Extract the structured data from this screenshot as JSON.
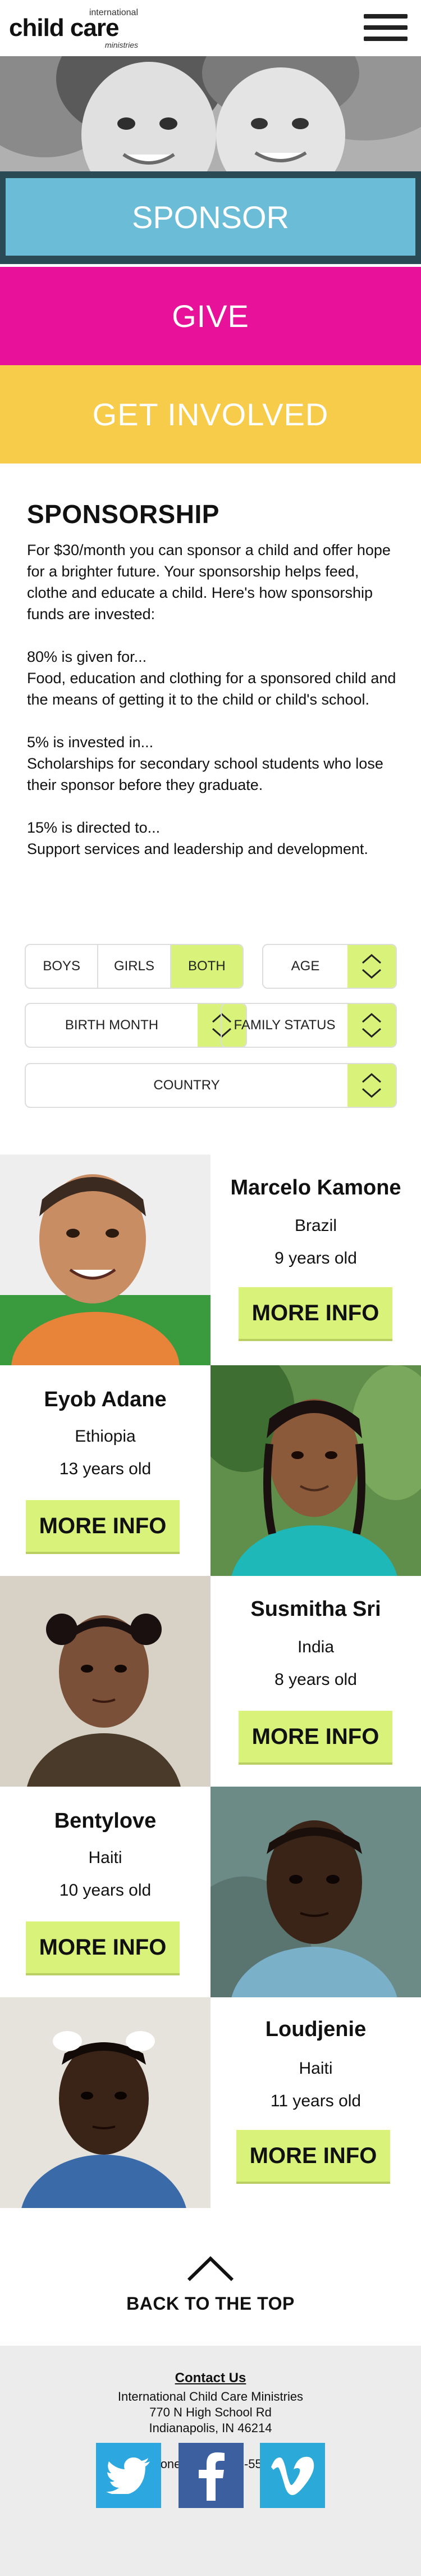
{
  "header": {
    "logo_top": "international",
    "logo_main": "child care",
    "logo_bottom": "ministries"
  },
  "actions": {
    "sponsor": "SPONSOR",
    "give": "GIVE",
    "get_involved": "GET INVOLVED"
  },
  "sponsorship": {
    "title": "SPONSORSHIP",
    "intro": "For $30/month you can sponsor a child and offer hope for a brighter future. Your  sponsorship helps feed, clothe and educate a child. Here's how sponsorship funds are invested:",
    "p1_head": "80% is given for...",
    "p1_body": "Food, education and clothing for a sponsored child and the means of getting it to the child or child's school.",
    "p2_head": "5% is invested in...",
    "p2_body": "Scholarships for secondary school students who lose their sponsor before they graduate.",
    "p3_head": "15% is directed to...",
    "p3_body": "Support services and leadership and development."
  },
  "filters": {
    "gender_options": [
      "BOYS",
      "GIRLS",
      "BOTH"
    ],
    "gender_selected": "BOTH",
    "age_label": "AGE",
    "birth_month_label": "BIRTH MONTH",
    "family_status_label": "FAMILY STATUS",
    "country_label": "COUNTRY"
  },
  "children": [
    {
      "name": "Marcelo Kamone",
      "country": "Brazil",
      "age": "9 years old",
      "button": "MORE INFO"
    },
    {
      "name": "Eyob Adane",
      "country": "Ethiopia",
      "age": "13 years old",
      "button": "MORE INFO"
    },
    {
      "name": "Susmitha Sri",
      "country": "India",
      "age": "8 years old",
      "button": "MORE INFO"
    },
    {
      "name": "Bentylove",
      "country": "Haiti",
      "age": "10 years old",
      "button": "MORE INFO"
    },
    {
      "name": "Loudjenie",
      "country": "Haiti",
      "age": "11 years old",
      "button": "MORE INFO"
    }
  ],
  "back_to_top": "BACK TO THE TOP",
  "footer": {
    "contact_title": "Contact Us",
    "org": "International Child Care Ministries",
    "address1": "770 N High School Rd",
    "address2": "Indianapolis, IN 46214",
    "phone": "Phone: 1-800-342-5531",
    "social": [
      "twitter-icon",
      "facebook-icon",
      "vimeo-icon"
    ]
  },
  "colors": {
    "sponsor_blue": "#6bbcd6",
    "give_pink": "#e8119a",
    "involved_yellow": "#f7cc4a",
    "lime": "#d8f27a",
    "footer_gray": "#ececec"
  }
}
